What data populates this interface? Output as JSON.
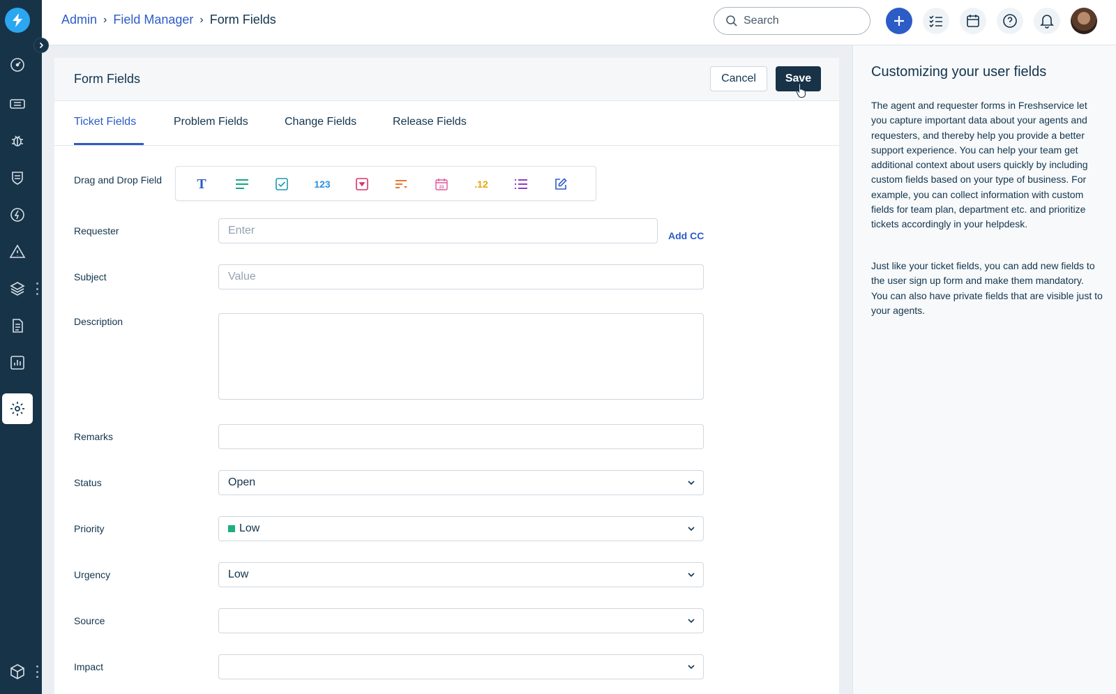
{
  "header": {
    "breadcrumb": [
      "Admin",
      "Field Manager",
      "Form Fields"
    ],
    "search_placeholder": "Search"
  },
  "page": {
    "title": "Form Fields",
    "cancel_label": "Cancel",
    "save_label": "Save"
  },
  "tabs": [
    "Ticket Fields",
    "Problem Fields",
    "Change Fields",
    "Release Fields"
  ],
  "active_tab": "Ticket Fields",
  "dnd": {
    "label": "Drag and Drop Field",
    "text_glyph": "T",
    "number_glyph": "123",
    "decimal_glyph": ".12",
    "icons": [
      "text-icon",
      "paragraph-icon",
      "checkbox-icon",
      "number-icon",
      "dropdown-icon",
      "dependent-field-icon",
      "date-icon",
      "decimal-icon",
      "multiselect-icon",
      "edit-field-icon"
    ]
  },
  "form": {
    "requester": {
      "label": "Requester",
      "placeholder": "Enter",
      "add_cc": "Add CC"
    },
    "subject": {
      "label": "Subject",
      "placeholder": "Value"
    },
    "description": {
      "label": "Description"
    },
    "remarks": {
      "label": "Remarks",
      "value": ""
    },
    "status": {
      "label": "Status",
      "value": "Open"
    },
    "priority": {
      "label": "Priority",
      "value": "Low",
      "color": "#1fae7e"
    },
    "urgency": {
      "label": "Urgency",
      "value": "Low"
    },
    "source": {
      "label": "Source",
      "value": ""
    },
    "impact": {
      "label": "Impact",
      "value": ""
    }
  },
  "help": {
    "title": "Customizing your user fields",
    "paragraph1": "The agent and requester forms in Freshservice let you capture important data about your agents and requesters, and thereby help you provide a better support experience. You can help your team get additional context about users quickly by including custom fields based on your type of business. For example, you can collect information with custom fields for team plan, department etc. and prioritize tickets accordingly in your helpdesk.",
    "paragraph2": "Just like your ticket fields, you can add new fields to the user sign up form and make them mandatory. You can also have private fields that are visible just to your agents."
  },
  "colors": {
    "sidebar": "#173348",
    "accent": "#2c5cc5",
    "save_button": "#183247"
  }
}
